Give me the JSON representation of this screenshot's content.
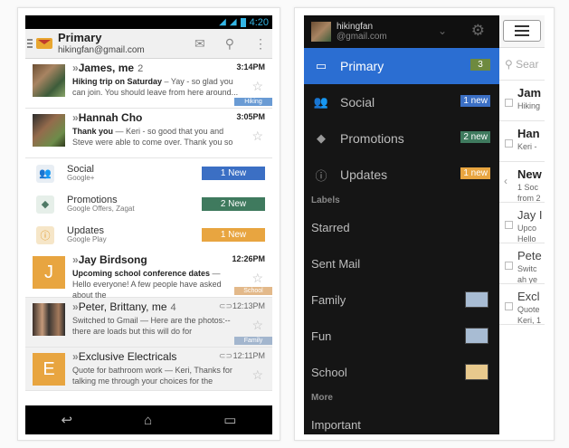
{
  "left": {
    "status": {
      "time": "4:20"
    },
    "actionbar": {
      "title": "Primary",
      "account": "hikingfan@gmail.com"
    },
    "emails": [
      {
        "chevrons": "»",
        "sender": "James, me",
        "count": "2",
        "time": "3:14PM",
        "subject": "Hiking trip on Saturday",
        "snippet": " – Yay - so glad you can join. You should leave from here around...",
        "label": "Hiking",
        "label_color": "#6a9bd4",
        "read": false,
        "avatar": "photo1"
      },
      {
        "chevrons": "»",
        "sender": "Hannah Cho",
        "count": "",
        "time": "3:05PM",
        "subject": "Thank you",
        "snippet": " — Keri - so good that you and Steve were able to come over. Thank you so",
        "label": "",
        "label_color": "",
        "read": false,
        "avatar": "photo2"
      },
      {
        "chevrons": "»",
        "sender": "Jay Birdsong",
        "count": "",
        "time": "12:26PM",
        "subject": "Upcoming school conference dates",
        "snippet": " — Hello everyone! A few people have asked about the",
        "label": "School",
        "label_color": "#e3b98a",
        "read": false,
        "avatar": "J",
        "avatar_color": "#e8a540"
      },
      {
        "chevrons": "»",
        "sender": "Peter, Brittany, me",
        "count": "4",
        "time": "12:13PM",
        "subject": "Switched to Gmail",
        "snippet": " — Here are the photos:--there are loads but this will do for",
        "label": "Family",
        "label_color": "#a3b6ce",
        "read": true,
        "avatar": "photo3"
      },
      {
        "chevrons": "»",
        "sender": "Exclusive Electricals",
        "count": "",
        "time": "12:11PM",
        "subject": "Quote for bathroom work",
        "snippet": " — Keri, Thanks for talking me through your choices for the",
        "label": "",
        "label_color": "",
        "read": true,
        "avatar": "E",
        "avatar_color": "#e8a540"
      }
    ],
    "categories": [
      {
        "name": "Social",
        "sub": "Google+",
        "badge": "1 New",
        "badge_color": "#3b6fc4",
        "icon": "people-icon"
      },
      {
        "name": "Promotions",
        "sub": "Google Offers, Zagat",
        "badge": "2 New",
        "badge_color": "#3f7a5e",
        "icon": "tag-icon"
      },
      {
        "name": "Updates",
        "sub": "Google Play",
        "badge": "1 New",
        "badge_color": "#e8a540",
        "icon": "info-icon"
      }
    ]
  },
  "right": {
    "account": {
      "name": "hikingfan",
      "email": "@gmail.com"
    },
    "inboxes": [
      {
        "label": "Primary",
        "badge": "3",
        "badge_color": "#6e8a3f",
        "active": true,
        "icon": "inbox-icon"
      },
      {
        "label": "Social",
        "badge": "1 new",
        "badge_color": "#3b6fc4",
        "active": false,
        "icon": "people-icon"
      },
      {
        "label": "Promotions",
        "badge": "2 new",
        "badge_color": "#3f7a5e",
        "active": false,
        "icon": "tag-icon"
      },
      {
        "label": "Updates",
        "badge": "1 new",
        "badge_color": "#e8a540",
        "active": false,
        "icon": "info-icon"
      }
    ],
    "labels_header": "Labels",
    "labels": [
      {
        "name": "Starred",
        "swatch": ""
      },
      {
        "name": "Sent Mail",
        "swatch": ""
      },
      {
        "name": "Family",
        "swatch": "#a8bcd3"
      },
      {
        "name": "Fun",
        "swatch": "#a8bcd3"
      },
      {
        "name": "School",
        "swatch": "#e8c98d"
      }
    ],
    "more_header": "More",
    "more_items": [
      {
        "name": "Important"
      }
    ],
    "list": {
      "search_placeholder": "Sear",
      "rows": [
        {
          "name": "Jam",
          "snippet": "Hiking",
          "bold": true
        },
        {
          "name": "Han",
          "snippet": "Keri -",
          "bold": true
        },
        {
          "name": "New",
          "snippet": "1 Soc",
          "extra": "from 2",
          "bold": true
        },
        {
          "name": "Jay I",
          "snippet": "Upco",
          "extra": "Hello",
          "bold": false
        },
        {
          "name": "Pete",
          "snippet": "Switc",
          "extra": "ah ye",
          "bold": false
        },
        {
          "name": "Excl",
          "snippet": "Quote",
          "extra": "Keri, 1",
          "bold": false
        }
      ]
    }
  }
}
